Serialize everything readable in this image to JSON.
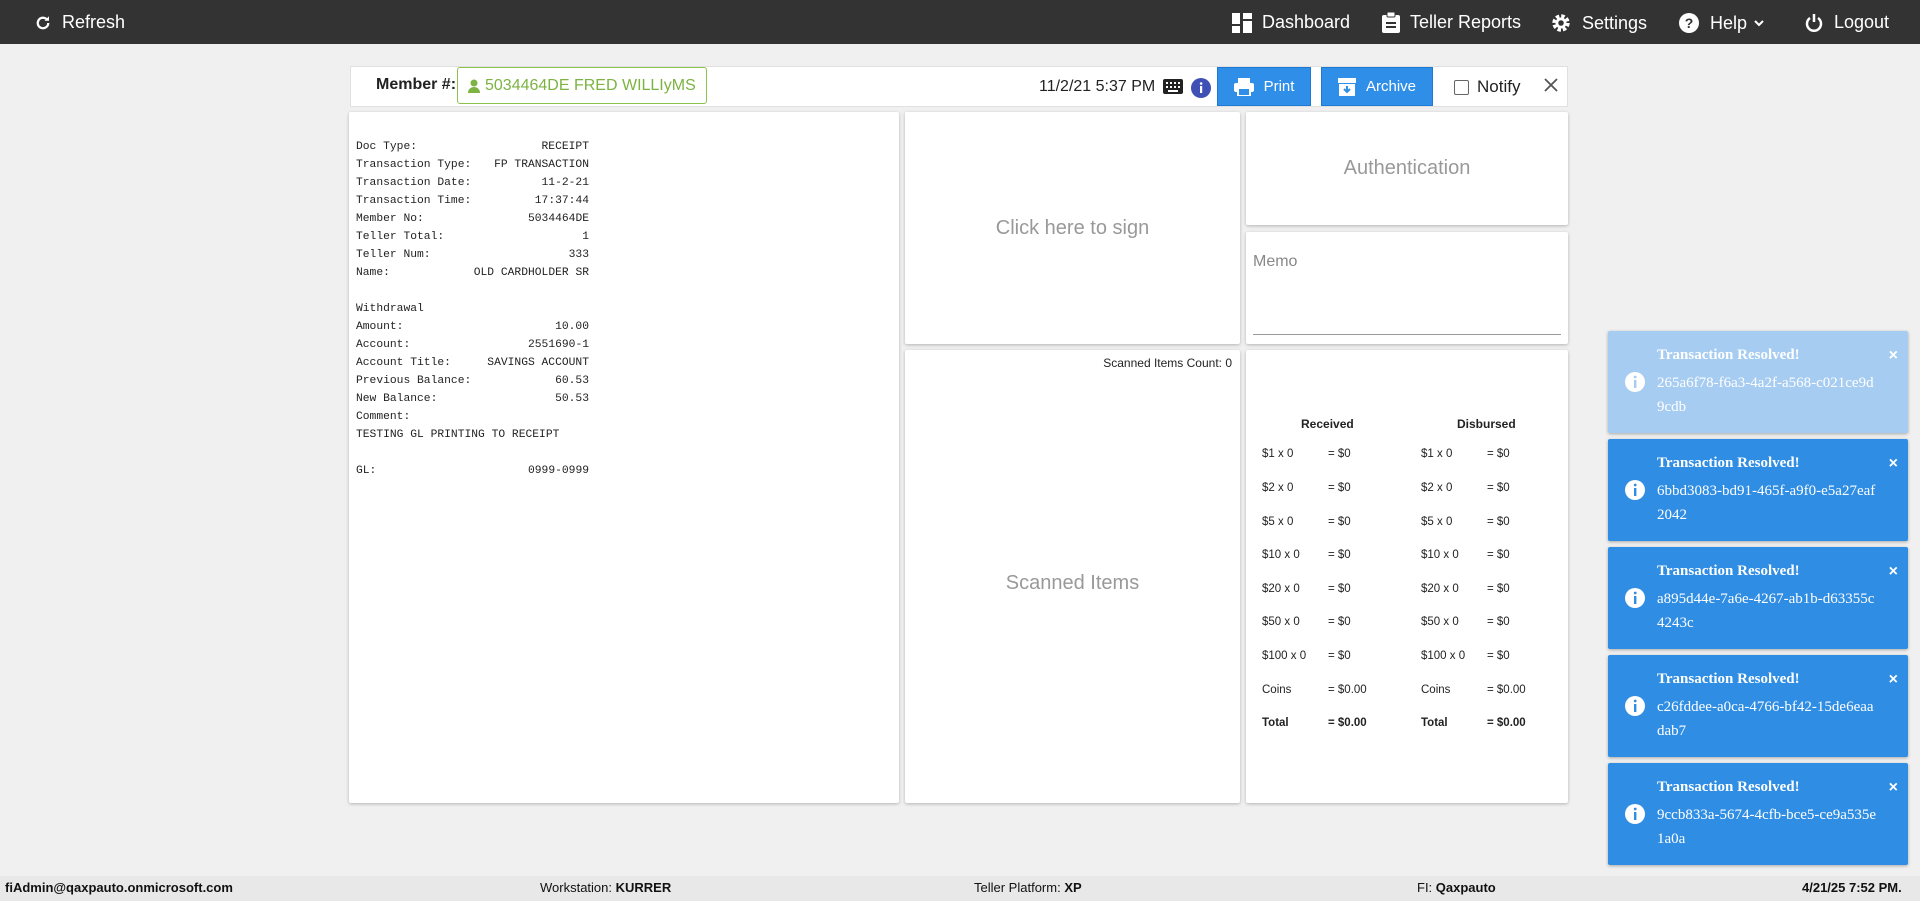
{
  "nav": {
    "refresh": "Refresh",
    "dashboard": "Dashboard",
    "teller_reports": "Teller Reports",
    "settings": "Settings",
    "help": "Help",
    "logout": "Logout"
  },
  "header": {
    "member_label": "Member #:",
    "member_value": "5034464DE FRED WILLIyMS",
    "datetime": "11/2/21 5:37 PM",
    "print": "Print",
    "archive": "Archive",
    "notify": "Notify"
  },
  "receipt": {
    "rows": [
      {
        "label": "Doc Type:",
        "value": "RECEIPT"
      },
      {
        "label": "Transaction Type:",
        "value": "FP TRANSACTION"
      },
      {
        "label": "Transaction Date:",
        "value": "11-2-21"
      },
      {
        "label": "Transaction Time:",
        "value": "17:37:44"
      },
      {
        "label": "Member No:",
        "value": "5034464DE"
      },
      {
        "label": "Teller Total:",
        "value": "1"
      },
      {
        "label": "Teller Num:",
        "value": "333"
      },
      {
        "label": "Name:",
        "value": "OLD CARDHOLDER SR"
      }
    ],
    "section": "Withdrawal",
    "rows2": [
      {
        "label": "Amount:",
        "value": "10.00"
      },
      {
        "label": "Account:",
        "value": "2551690-1"
      },
      {
        "label": "Account Title:",
        "value": "SAVINGS ACCOUNT"
      },
      {
        "label": "Previous Balance:",
        "value": "60.53"
      },
      {
        "label": "New Balance:",
        "value": "50.53"
      }
    ],
    "comment_label": "Comment:",
    "comment": "TESTING GL PRINTING TO RECEIPT",
    "gl_label": "GL:",
    "gl_value": "0999-0999"
  },
  "signature": {
    "prompt": "Click here to sign"
  },
  "scanned": {
    "count_label": "Scanned Items Count: 0",
    "title": "Scanned Items"
  },
  "auth": {
    "title": "Authentication"
  },
  "memo": {
    "label": "Memo"
  },
  "cash": {
    "received_header": "Received",
    "disbursed_header": "Disbursed",
    "received": [
      {
        "denom": "$1",
        "x": "x 0",
        "eq": "= $0"
      },
      {
        "denom": "$2",
        "x": "x 0",
        "eq": "= $0"
      },
      {
        "denom": "$5",
        "x": "x 0",
        "eq": "= $0"
      },
      {
        "denom": "$10",
        "x": "x 0",
        "eq": "= $0"
      },
      {
        "denom": "$20",
        "x": "x 0",
        "eq": "= $0"
      },
      {
        "denom": "$50",
        "x": "x 0",
        "eq": "= $0"
      },
      {
        "denom": "$100",
        "x": "x 0",
        "eq": "= $0"
      },
      {
        "denom": "Coins",
        "x": "",
        "eq": "= $0.00"
      }
    ],
    "disbursed": [
      {
        "denom": "$1",
        "x": "x 0",
        "eq": "= $0"
      },
      {
        "denom": "$2",
        "x": "x 0",
        "eq": "= $0"
      },
      {
        "denom": "$5",
        "x": "x 0",
        "eq": "= $0"
      },
      {
        "denom": "$10",
        "x": "x 0",
        "eq": "= $0"
      },
      {
        "denom": "$20",
        "x": "x 0",
        "eq": "= $0"
      },
      {
        "denom": "$50",
        "x": "x 0",
        "eq": "= $0"
      },
      {
        "denom": "$100",
        "x": "x 0",
        "eq": "= $0"
      },
      {
        "denom": "Coins",
        "x": "",
        "eq": "= $0.00"
      }
    ],
    "total_label": "Total",
    "received_total": "= $0.00",
    "disbursed_total": "= $0.00"
  },
  "toasts": [
    {
      "title": "Transaction Resolved!",
      "message": "265a6f78-f6a3-4a2f-a568-c021ce9d9cdb",
      "faded": true
    },
    {
      "title": "Transaction Resolved!",
      "message": "6bbd3083-bd91-465f-a9f0-e5a27eaf2042",
      "faded": false
    },
    {
      "title": "Transaction Resolved!",
      "message": "a895d44e-7a6e-4267-ab1b-d63355c4243c",
      "faded": false
    },
    {
      "title": "Transaction Resolved!",
      "message": "c26fddee-a0ca-4766-bf42-15de6eaadab7",
      "faded": false
    },
    {
      "title": "Transaction Resolved!",
      "message": "9ccb833a-5674-4cfb-bce5-ce9a535e1a0a",
      "faded": false
    }
  ],
  "footer": {
    "user": "fiAdmin@qaxpauto.onmicrosoft.com",
    "workstation_label": "Workstation: ",
    "workstation": "KURRER",
    "platform_label": "Teller Platform: ",
    "platform": "XP",
    "fi_label": "FI: ",
    "fi": "Qaxpauto",
    "datetime": "4/21/25 7:52 PM."
  },
  "colors": {
    "nav_bg": "#333333",
    "accent": "#2f8ee8",
    "member_green": "#7cb342",
    "toast": "#2f8de4"
  }
}
